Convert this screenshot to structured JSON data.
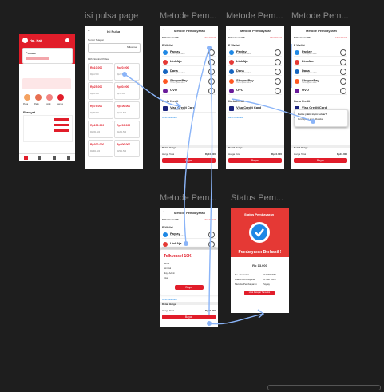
{
  "frames": {
    "isi_pulsa": "isi pulsa page",
    "metode_1": "Metode Pem...",
    "metode_2": "Metode Pem...",
    "metode_3": "Metode Pem...",
    "metode_4": "Metode Pem...",
    "status": "Status Pem..."
  },
  "home": {
    "user": "Hai, Kak",
    "promo": "Promo",
    "menu": [
      "Pulsa",
      "Paket",
      "Listrik",
      "Games"
    ],
    "section": "Riwayat"
  },
  "isi_pulsa": {
    "header": "Isi Pulsa",
    "field_label": "Nomor Telepon",
    "provider": "Telkomsel",
    "list_label": "Pilih Nominal Pulsa",
    "cards": [
      {
        "value": "Rp10.000",
        "price": "Rp11.500"
      },
      {
        "value": "Rp20.000",
        "price": "Rp21.500"
      },
      {
        "value": "Rp25.000",
        "price": "Rp26.500"
      },
      {
        "value": "Rp50.000",
        "price": "Rp51.500"
      },
      {
        "value": "Rp75.000",
        "price": "Rp76.500"
      },
      {
        "value": "Rp100.000",
        "price": "Rp101.500"
      },
      {
        "value": "Rp150.000",
        "price": "Rp151.500"
      },
      {
        "value": "Rp200.000",
        "price": "Rp201.500"
      },
      {
        "value": "Rp300.000",
        "price": "Rp301.500"
      },
      {
        "value": "Rp500.000",
        "price": "Rp501.500"
      }
    ]
  },
  "metode": {
    "header": "Metode Pembayaran",
    "product": "Telkomsel 10K",
    "detail_link": "Lihat Detail",
    "ewallet_label": "E-Wallet",
    "ewallets": [
      {
        "name": "Paylay",
        "sub": "Hubungkan akun",
        "color": "#1e88e5"
      },
      {
        "name": "LinkAja",
        "sub": "",
        "color": "#e53935"
      },
      {
        "name": "Dana",
        "sub": "Hubungkan akun",
        "color": "#1565c0"
      },
      {
        "name": "ShopeePay",
        "sub": "Hubungkan akun",
        "color": "#ff5722"
      },
      {
        "name": "OVO",
        "sub": "",
        "color": "#6a1b9a"
      }
    ],
    "card_label": "Kartu Kredit",
    "card_name": "Visa Credit Card",
    "card_sub": "Tambahkan kartu",
    "note": "Kartu kredit/debit",
    "summary_label": "Detail Harga",
    "total_label": "Harga Total",
    "total": "Rp10.000",
    "pay_button": "Bayar"
  },
  "popup": {
    "title": "Telkomsel 10K",
    "rows": [
      "Nomor",
      "Nominal",
      "Biaya Admin",
      "Total"
    ],
    "button": "Bayar"
  },
  "dialog": {
    "title": "Kamu yakin ingin keluar?",
    "text": "Pembayaran akan dibatalkan"
  },
  "status": {
    "header": "Status Pembayaran",
    "message": "Pembayaran Berhasil !",
    "amount": "Rp 13.000",
    "rows": [
      {
        "k": "No. Transaksi",
        "v": "0123456789"
      },
      {
        "k": "Waktu Pembayaran",
        "v": "20 Mei 2024"
      },
      {
        "k": "Metode Pembayaran",
        "v": "Paylay"
      }
    ],
    "button": "Lihat Riwayat Transaksi"
  },
  "colors": {
    "brand": "#e11d2a",
    "canvas": "#1e1e1e",
    "connector": "#8ab4f8",
    "status_bg": "#e53935"
  }
}
